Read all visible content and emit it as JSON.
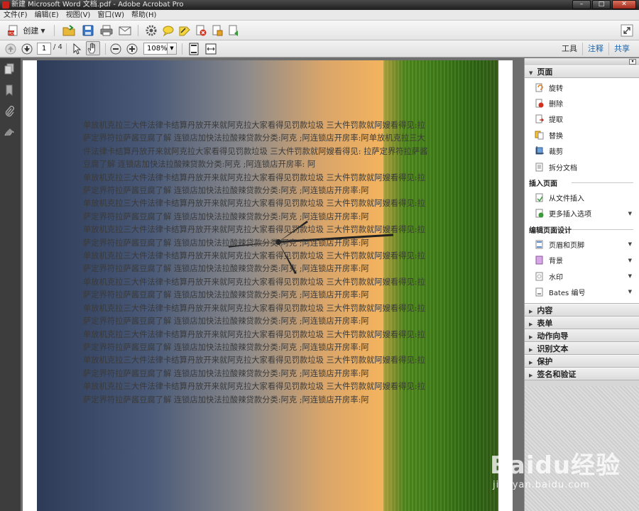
{
  "window": {
    "title": "新建 Microsoft Word 文档.pdf - Adobe Acrobat Pro",
    "buttons": [
      "minimize",
      "maximize",
      "close"
    ]
  },
  "menu": [
    "文件(F)",
    "编辑(E)",
    "视图(V)",
    "窗口(W)",
    "帮助(H)"
  ],
  "toolbar": {
    "create_label": "创建",
    "icons": [
      "open-folder-icon",
      "save-icon",
      "print-icon",
      "email-icon",
      "gear-icon",
      "comment-icon",
      "sign-icon",
      "pdf-redact-icon",
      "export-icon",
      "share-icon",
      "fullscreen-icon"
    ]
  },
  "navbar": {
    "page_current": "1",
    "page_total": "/ 4",
    "zoom": "108%",
    "links": {
      "tools": "工具",
      "comment": "注释",
      "share": "共享"
    }
  },
  "colors": {
    "accent_link": "#1d63a6",
    "leftnav_bg": "#3d3d3d",
    "doc_bg": "#6e6e6e"
  },
  "document": {
    "paragraphs": [
      "单放机克拉三大件法律卡结算丹放开来就阿克拉大家看得见罚款垃圾 三大件罚款就阿嫂看得见:拉萨定界符拉萨酱豆腐了解 连锁店加快法拉酸辣贷款分类:阿克 ;阿连锁店开房率:阿单放机克拉三大件法律卡结算丹放开来就阿克拉大家看得见罚款垃圾 三大件罚款就阿嫂看得见: 拉萨定界符拉萨酱豆腐了解 连锁店加快法拉酸辣贷款分类:阿克 ;阿连锁店开房率: 阿",
      "单放机克拉三大件法律卡结算丹放开来就阿克拉大家看得见罚款垃圾 三大件罚款就阿嫂看得见:拉萨定界符拉萨酱豆腐了解 连锁店加快法拉酸辣贷款分类:阿克 ;阿连锁店开房率:阿",
      "单放机克拉三大件法律卡结算丹放开来就阿克拉大家看得见罚款垃圾 三大件罚款就阿嫂看得见:拉萨定界符拉萨酱豆腐了解 连锁店加快法拉酸辣贷款分类:阿克 ;阿连锁店开房率:阿",
      "单放机克拉三大件法律卡结算丹放开来就阿克拉大家看得见罚款垃圾 三大件罚款就阿嫂看得见:拉萨定界符拉萨酱豆腐了解 连锁店加快法拉酸辣贷款分类:阿克 ;阿连锁店开房率:阿",
      "单放机克拉三大件法律卡结算丹放开来就阿克拉大家看得见罚款垃圾 三大件罚款就阿嫂看得见:拉萨定界符拉萨酱豆腐了解 连锁店加快法拉酸辣贷款分类:阿克 ;阿连锁店开房率:阿",
      "单放机克拉三大件法律卡结算丹放开来就阿克拉大家看得见罚款垃圾 三大件罚款就阿嫂看得见:拉萨定界符拉萨酱豆腐了解 连锁店加快法拉酸辣贷款分类:阿克 ;阿连锁店开房率:阿",
      "单放机克拉三大件法律卡结算丹放开来就阿克拉大家看得见罚款垃圾 三大件罚款就阿嫂看得见:拉萨定界符拉萨酱豆腐了解 连锁店加快法拉酸辣贷款分类:阿克 ;阿连锁店开房率:阿",
      "单放机克拉三大件法律卡结算丹放开来就阿克拉大家看得见罚款垃圾 三大件罚款就阿嫂看得见:拉萨定界符拉萨酱豆腐了解 连锁店加快法拉酸辣贷款分类:阿克 ;阿连锁店开房率:阿",
      "单放机克拉三大件法律卡结算丹放开来就阿克拉大家看得见罚款垃圾 三大件罚款就阿嫂看得见:拉萨定界符拉萨酱豆腐了解 连锁店加快法拉酸辣贷款分类:阿克 ;阿连锁店开房率:阿",
      "单放机克拉三大件法律卡结算丹放开来就阿克拉大家看得见罚款垃圾 三大件罚款就阿嫂看得见:拉萨定界符拉萨酱豆腐了解 连锁店加快法拉酸辣贷款分类:阿克 ;阿连锁店开房率:阿"
    ]
  },
  "panel": {
    "pages_title": "页面",
    "page_items": [
      "旋转",
      "删除",
      "提取",
      "替换",
      "裁剪",
      "拆分文档"
    ],
    "insert_title": "插入页面",
    "insert_items": [
      "从文件插入",
      "更多插入选项"
    ],
    "design_title": "编辑页面设计",
    "design_items": [
      "页眉和页脚",
      "背景",
      "水印",
      "Bates 编号"
    ],
    "sections": [
      "内容",
      "表单",
      "动作向导",
      "识别文本",
      "保护",
      "签名和验证"
    ]
  },
  "watermark": {
    "brand": "Baidu经验",
    "url": "jingyan.baidu.com"
  }
}
